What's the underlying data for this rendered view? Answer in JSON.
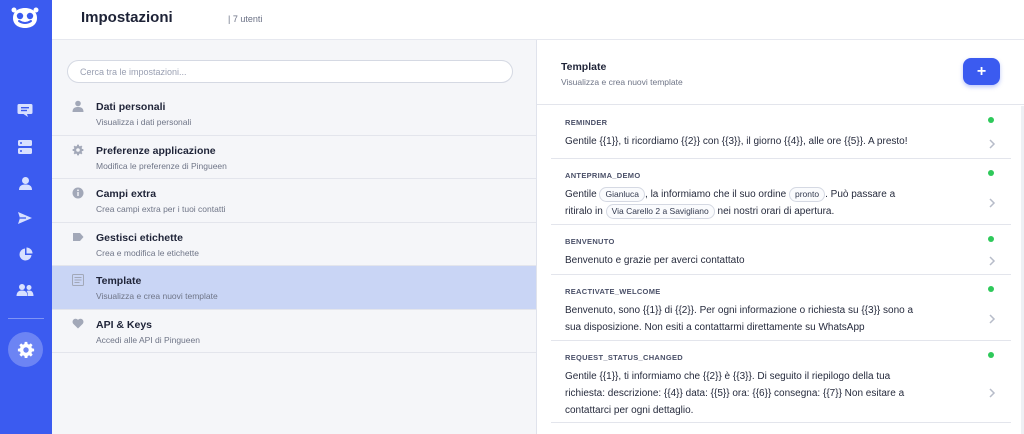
{
  "header": {
    "title": "Impostazioni",
    "user_count": "| 7 utenti"
  },
  "rail": {
    "icons": [
      "chat-icon",
      "server-icon",
      "user-icon",
      "send-icon",
      "pie-chart-icon",
      "users-icon",
      "gear-icon"
    ],
    "accent": "#3b5bf0"
  },
  "search": {
    "placeholder": "Cerca tra le impostazioni...",
    "value": ""
  },
  "menu": [
    {
      "label": "Dati personali",
      "sub": "Visualizza i dati personali",
      "icon": "person-icon"
    },
    {
      "label": "Preferenze applicazione",
      "sub": "Modifica le preferenze di Pingueen",
      "icon": "gear-icon"
    },
    {
      "label": "Campi extra",
      "sub": "Crea campi extra per i tuoi contatti",
      "icon": "info-icon"
    },
    {
      "label": "Gestisci etichette",
      "sub": "Crea e modifica le etichette",
      "icon": "tag-icon"
    },
    {
      "label": "Template",
      "sub": "Visualizza e crea nuovi template",
      "icon": "template-icon",
      "active": true
    },
    {
      "label": "API & Keys",
      "sub": "Accedi alle API di Pingueen",
      "icon": "heart-icon"
    }
  ],
  "panel": {
    "title": "Template",
    "subtitle": "Visualizza e crea nuovi template",
    "add_label": "+"
  },
  "templates": [
    {
      "name": "REMINDER",
      "body": "Gentile {{1}}, ti ricordiamo {{2}} con {{3}}, il giorno {{4}}, alle ore {{5}}. A presto!",
      "status_color": "#2ec95a"
    },
    {
      "name": "ANTEPRIMA_DEMO",
      "body_parts": [
        "Gentile",
        "Gianluca",
        ", la informiamo che il suo ordine",
        "pronto",
        ". Può passare a ritiralo in",
        "Via Carello 2 a Savigliano",
        "nei nostri orari di apertura."
      ],
      "status_color": "#2ec95a"
    },
    {
      "name": "BENVENUTO",
      "body": "Benvenuto e grazie per averci contattato",
      "status_color": "#2ec95a"
    },
    {
      "name": "REACTIVATE_WELCOME",
      "body": "Benvenuto, sono {{1}} di {{2}}. Per ogni informazione o richiesta su {{3}} sono a sua disposizione. Non esiti a contattarmi direttamente su WhatsApp",
      "status_color": "#2ec95a"
    },
    {
      "name": "REQUEST_STATUS_CHANGED",
      "body": "Gentile {{1}}, ti informiamo che {{2}} è {{3}}. Di seguito il riepilogo della tua richiesta: descrizione: {{4}} data: {{5}} ora: {{6}} consegna: {{7}} Non esitare a contattarci per ogni dettaglio.",
      "status_color": "#2ec95a"
    }
  ]
}
